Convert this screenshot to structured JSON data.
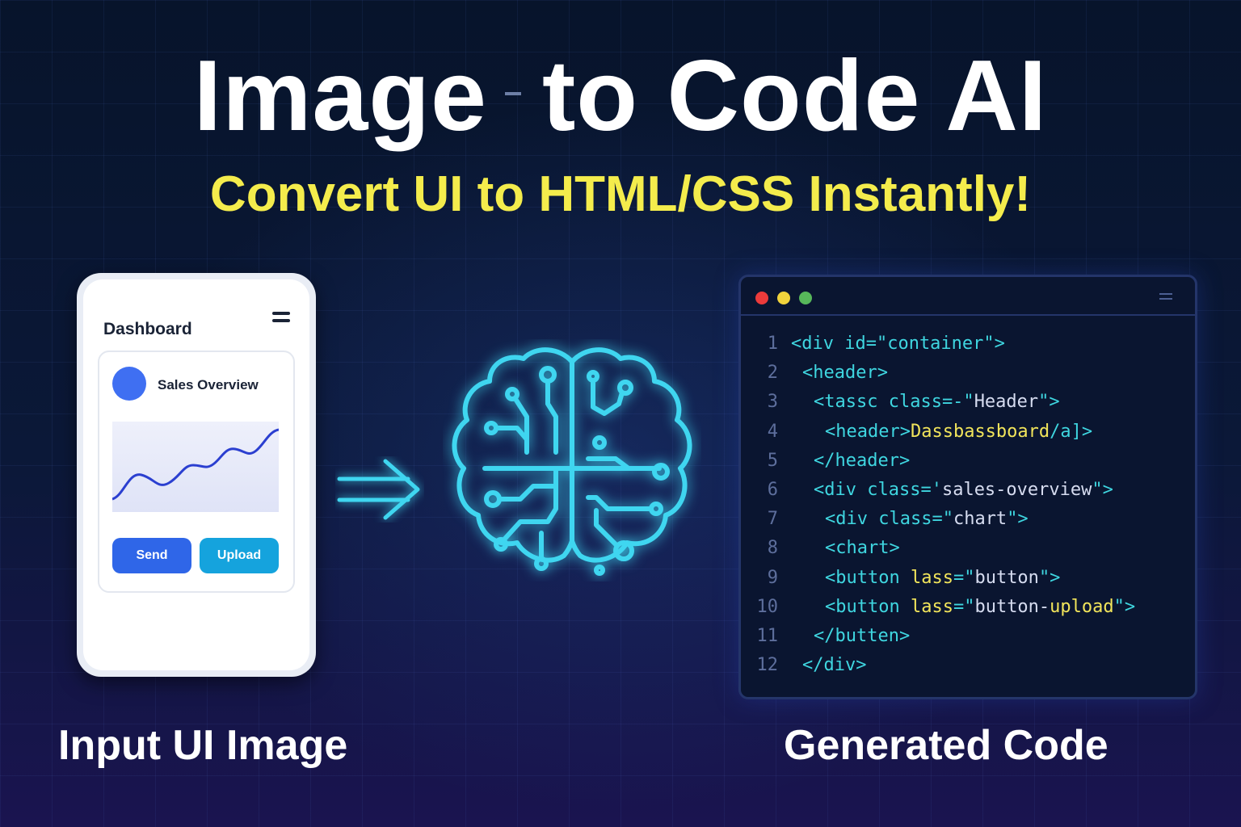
{
  "title_left": "Image",
  "title_right": "to Code AI",
  "subtitle": "Convert UI to HTML/CSS Instantly!",
  "phone": {
    "heading": "Dashboard",
    "card_title": "Sales Overview",
    "send_label": "Send",
    "upload_label": "Upload"
  },
  "colors": {
    "accent_yellow": "#f4ec4c",
    "brain_glow": "#3fd6f0",
    "send_blue": "#2f66e8",
    "upload_cyan": "#15a3dd"
  },
  "code": {
    "lines": [
      {
        "n": "1",
        "parts": [
          {
            "c": "t-tag",
            "t": "<div id=\"container\">"
          }
        ],
        "indent": 0
      },
      {
        "n": "2",
        "parts": [
          {
            "c": "t-tag",
            "t": "<header>"
          }
        ],
        "indent": 1
      },
      {
        "n": "3",
        "parts": [
          {
            "c": "t-tag",
            "t": "<tassc class=-\""
          },
          {
            "c": "t-str",
            "t": "Header"
          },
          {
            "c": "t-tag",
            "t": "\">"
          }
        ],
        "indent": 2
      },
      {
        "n": "4",
        "parts": [
          {
            "c": "t-tag",
            "t": "<header>"
          },
          {
            "c": "t-attr",
            "t": "Dassbassboard"
          },
          {
            "c": "t-tag",
            "t": "/a]>"
          }
        ],
        "indent": 3
      },
      {
        "n": "5",
        "parts": [
          {
            "c": "t-tag",
            "t": "</header>"
          }
        ],
        "indent": 2
      },
      {
        "n": "6",
        "parts": [
          {
            "c": "t-tag",
            "t": "<div class='"
          },
          {
            "c": "t-str",
            "t": "sales-overview"
          },
          {
            "c": "t-tag",
            "t": "\">"
          }
        ],
        "indent": 2
      },
      {
        "n": "7",
        "parts": [
          {
            "c": "t-tag",
            "t": "<div class=\""
          },
          {
            "c": "t-str",
            "t": "chart"
          },
          {
            "c": "t-tag",
            "t": "\">"
          }
        ],
        "indent": 3
      },
      {
        "n": "8",
        "parts": [
          {
            "c": "t-tag",
            "t": "<chart>"
          }
        ],
        "indent": 3
      },
      {
        "n": "9",
        "parts": [
          {
            "c": "t-tag",
            "t": "<button "
          },
          {
            "c": "t-attr",
            "t": "lass"
          },
          {
            "c": "t-tag",
            "t": "=\""
          },
          {
            "c": "t-str",
            "t": "button"
          },
          {
            "c": "t-tag",
            "t": "\">"
          }
        ],
        "indent": 3
      },
      {
        "n": "10",
        "parts": [
          {
            "c": "t-tag",
            "t": "<button "
          },
          {
            "c": "t-attr",
            "t": "lass"
          },
          {
            "c": "t-tag",
            "t": "=\""
          },
          {
            "c": "t-str",
            "t": "button-"
          },
          {
            "c": "t-attr",
            "t": "upload"
          },
          {
            "c": "t-tag",
            "t": "\">"
          }
        ],
        "indent": 3
      },
      {
        "n": "11",
        "parts": [
          {
            "c": "t-tag",
            "t": "</butten>"
          }
        ],
        "indent": 2
      },
      {
        "n": "12",
        "parts": [
          {
            "c": "t-tag",
            "t": "</div>"
          }
        ],
        "indent": 1
      }
    ]
  },
  "caption_left": "Input UI Image",
  "caption_right": "Generated Code"
}
